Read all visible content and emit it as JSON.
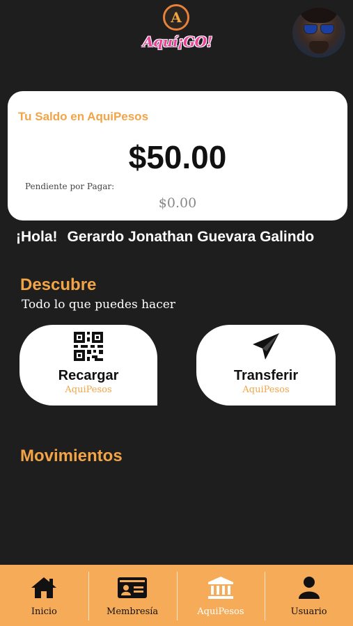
{
  "header": {
    "logo_badge_letter": "A",
    "logo_text": "Aquí¡GO!"
  },
  "balance": {
    "title": "Tu Saldo en AquiPesos",
    "amount": "$50.00",
    "pending_label": "Pendiente por Pagar:",
    "pending_value": "$0.00"
  },
  "greeting": {
    "hello": "¡Hola!",
    "name": "Gerardo Jonathan Guevara Galindo"
  },
  "discover": {
    "title": "Descubre",
    "subtitle": "Todo lo que puedes hacer",
    "actions": [
      {
        "label": "Recargar",
        "sub": "AquiPesos",
        "icon": "qr-code-icon"
      },
      {
        "label": "Transferir",
        "sub": "AquiPesos",
        "icon": "paper-plane-icon"
      }
    ]
  },
  "movements": {
    "title": "Movimientos"
  },
  "nav": {
    "items": [
      {
        "label": "Inicio",
        "icon": "home-icon"
      },
      {
        "label": "Membresía",
        "icon": "id-card-icon"
      },
      {
        "label": "AquiPesos",
        "icon": "bank-icon",
        "active": true
      },
      {
        "label": "Usuario",
        "icon": "user-icon"
      }
    ]
  },
  "colors": {
    "accent": "#f2a446",
    "background": "#1e1e1e",
    "nav_bg": "#f5ab58",
    "logo_pink": "#e8459a"
  }
}
